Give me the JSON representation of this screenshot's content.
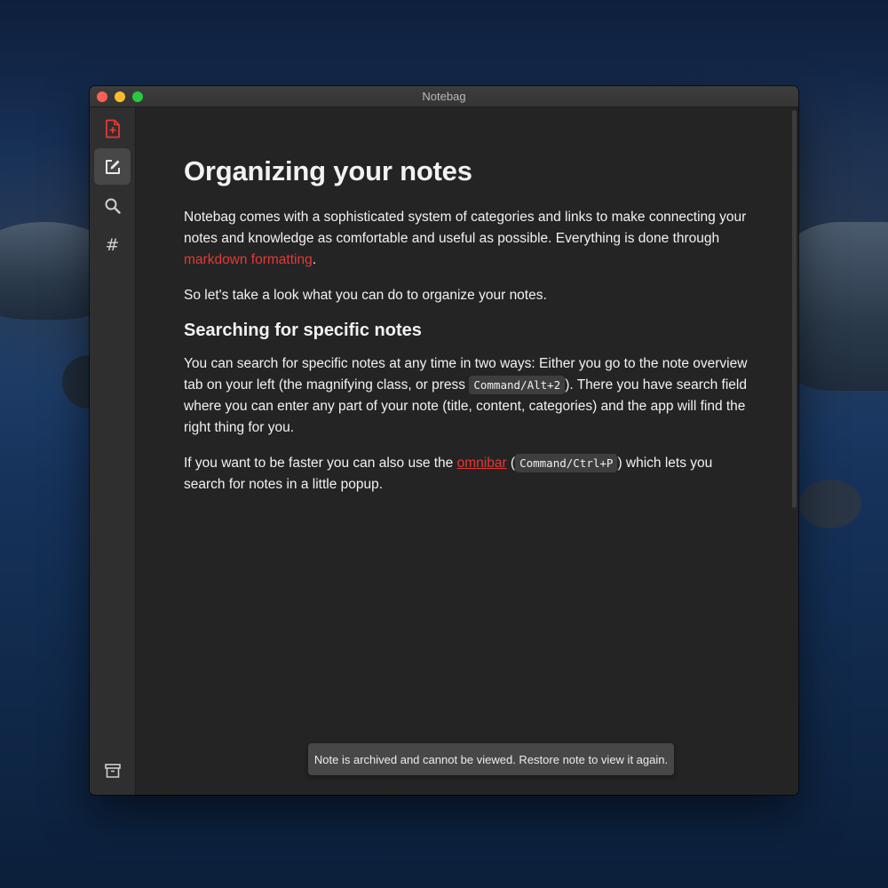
{
  "window": {
    "title": "Notebag"
  },
  "colors": {
    "accent": "#e53935",
    "background": "#242424",
    "sidebar": "#2f2f2f"
  },
  "sidebar": {
    "items": [
      {
        "name": "new-note",
        "icon": "file-plus-icon",
        "active": false
      },
      {
        "name": "editor",
        "icon": "edit-icon",
        "active": true
      },
      {
        "name": "search",
        "icon": "search-icon",
        "active": false
      },
      {
        "name": "categories",
        "icon": "hash-icon",
        "glyph": "#",
        "active": false
      },
      {
        "name": "archive",
        "icon": "archive-box-icon",
        "active": false
      }
    ]
  },
  "note": {
    "title": "Organizing your notes",
    "p1_text": "Notebag comes with a sophisticated system of categories and links to make connecting your notes and knowledge as comfortable and useful as possible. Everything is done through ",
    "p1_link": "markdown formatting",
    "p1_end": ".",
    "p2": "So let's take a look what you can do to organize your notes.",
    "h2": "Searching for specific notes",
    "p3_a": "You can search for specific notes at any time in two ways: Either you go to the note overview tab on your left (the magnifying class, or press ",
    "p3_code": "Command/Alt+2",
    "p3_b": "). There you have search field where you can enter any part of your note (title, content, categories) and the app will find the right thing for you.",
    "p4_a": "If you want to be faster you can also use the ",
    "p4_link": "omnibar",
    "p4_b": " (",
    "p4_code": "Command/Ctrl+P",
    "p4_c": ") which lets you search for notes in a little popup."
  },
  "toast": {
    "message": "Note is archived and cannot be viewed. Restore note to view it again."
  }
}
